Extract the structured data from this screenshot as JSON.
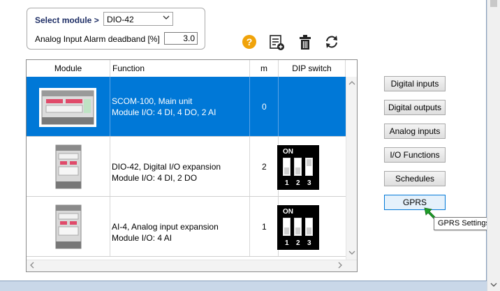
{
  "module_selector": {
    "label": "Select module >",
    "selected": "DIO-42",
    "deadband_label": "Analog Input Alarm deadband [%]",
    "deadband_value": "3.0"
  },
  "toolbar": {
    "help_glyph": "?",
    "icons": [
      "help-icon",
      "add-list-icon",
      "delete-icon",
      "refresh-icon"
    ]
  },
  "grid": {
    "columns": [
      "Module",
      "Function",
      "m",
      "DIP switch"
    ],
    "rows": [
      {
        "function_line1": "SCOM-100, Main unit",
        "function_line2": "Module I/O: 4 DI, 4 DO, 2 AI",
        "m": "0",
        "dip": null,
        "selected": true
      },
      {
        "function_line1": "DIO-42, Digital I/O expansion",
        "function_line2": "Module I/O: 4 DI, 2 DO",
        "m": "2",
        "dip": {
          "on_label": "ON",
          "numbers": [
            "1",
            "2",
            "3"
          ],
          "states": [
            "off",
            "off",
            "on"
          ]
        },
        "selected": false
      },
      {
        "function_line1": "AI-4, Analog input expansion",
        "function_line2": "Module I/O: 4 AI",
        "m": "1",
        "dip": {
          "on_label": "ON",
          "numbers": [
            "1",
            "2",
            "3"
          ],
          "states": [
            "off",
            "off",
            "off"
          ]
        },
        "selected": false
      }
    ]
  },
  "side_buttons": [
    "Digital inputs",
    "Digital outputs",
    "Analog inputs",
    "I/O Functions",
    "Schedules",
    "GPRS"
  ],
  "tooltip": "GPRS Settings",
  "colors": {
    "selection": "#0078d7",
    "help": "#f0a30a",
    "pointer": "#1e9e2a",
    "module_label": "#1f2f66"
  }
}
